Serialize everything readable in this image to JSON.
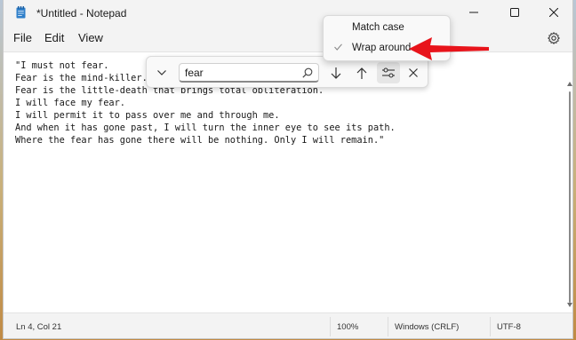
{
  "window": {
    "title": "*Untitled - Notepad",
    "icon": "notepad-icon",
    "controls": [
      "minimize-icon",
      "maximize-icon",
      "close-icon"
    ]
  },
  "menu": {
    "file": "File",
    "edit": "Edit",
    "view": "View",
    "settings_icon": "gear-icon"
  },
  "editor": {
    "lines": [
      "\"I must not fear.",
      "Fear is the mind-killer.",
      "Fear is the little-death that brings total obliteration.",
      "I will face my fear.",
      "I will permit it to pass over me and through me.",
      "And when it has gone past, I will turn the inner eye to see its path.",
      "Where the fear has gone there will be nothing. Only I will remain.\""
    ]
  },
  "find": {
    "query": "fear",
    "icons": {
      "expand": "chevron-down-icon",
      "search": "search-icon",
      "next": "arrow-down-icon",
      "previous": "arrow-up-icon",
      "options": "sliders-icon",
      "close": "close-icon"
    },
    "options": {
      "match_case": "Match case",
      "match_case_checked": false,
      "wrap_around": "Wrap around",
      "wrap_around_checked": true,
      "check_icon": "checkmark-icon"
    }
  },
  "status": {
    "position": "Ln 4, Col 21",
    "zoom": "100%",
    "line_endings": "Windows (CRLF)",
    "encoding": "UTF-8"
  },
  "annotation": {
    "arrow_icon": "red-arrow-icon",
    "arrow_color": "#e8141b"
  }
}
